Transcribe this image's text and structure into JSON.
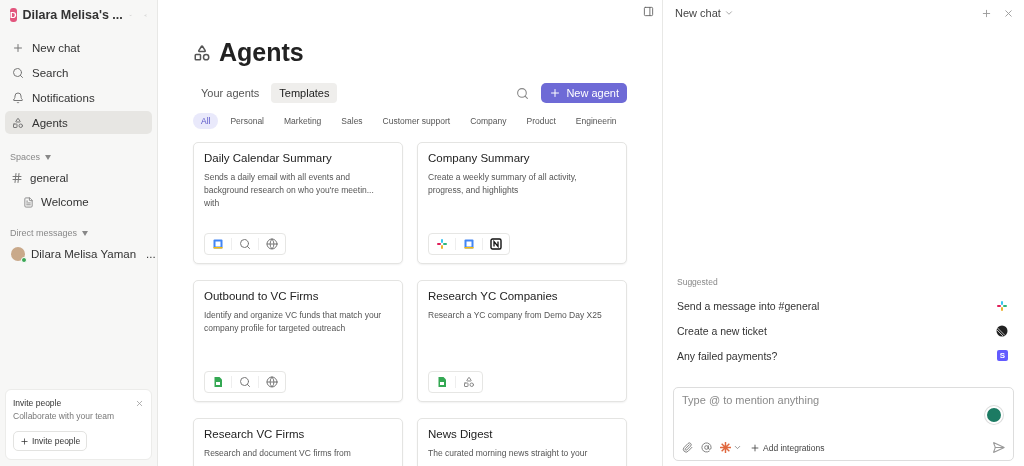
{
  "workspace": {
    "initial": "D",
    "name": "Dilara Melisa's ..."
  },
  "nav": [
    {
      "kind": "plus",
      "label": "New chat",
      "selected": false
    },
    {
      "kind": "search",
      "label": "Search",
      "selected": false
    },
    {
      "kind": "bell",
      "label": "Notifications",
      "selected": false
    },
    {
      "kind": "agents",
      "label": "Agents",
      "selected": true
    }
  ],
  "spaces": {
    "title": "Spaces",
    "items": [
      {
        "label": "general",
        "children": [
          {
            "label": "Welcome"
          }
        ]
      }
    ]
  },
  "direct_messages": {
    "title": "Direct messages",
    "items": [
      {
        "name": "Dilara Melisa Yaman",
        "more": "..."
      }
    ]
  },
  "invite": {
    "title": "Invite people",
    "text": "Collaborate with your team",
    "button": "Invite people"
  },
  "page": {
    "title": "Agents",
    "tabs": [
      {
        "label": "Your agents",
        "selected": false
      },
      {
        "label": "Templates",
        "selected": true
      }
    ],
    "new_button": "New agent",
    "filters": [
      {
        "label": "All",
        "selected": true
      },
      {
        "label": "Personal",
        "selected": false
      },
      {
        "label": "Marketing",
        "selected": false
      },
      {
        "label": "Sales",
        "selected": false
      },
      {
        "label": "Customer support",
        "selected": false
      },
      {
        "label": "Company",
        "selected": false
      },
      {
        "label": "Product",
        "selected": false
      },
      {
        "label": "Engineerin",
        "selected": false
      }
    ],
    "cards": [
      {
        "title": "Daily Calendar Summary",
        "description": "Sends a daily email with all events and background research on who you're meetin... with",
        "tools": [
          {
            "kind": "calendar"
          },
          {
            "kind": "search"
          },
          {
            "kind": "globe"
          }
        ]
      },
      {
        "title": "Company Summary",
        "description": "Create a weekly summary of all activity, progress, and highlights",
        "tools": [
          {
            "kind": "slack"
          },
          {
            "kind": "calendar"
          },
          {
            "kind": "notion"
          }
        ]
      },
      {
        "title": "Outbound to VC Firms",
        "description": "Identify and organize VC funds that match your company profile for targeted outreach",
        "tools": [
          {
            "kind": "sheets"
          },
          {
            "kind": "search"
          },
          {
            "kind": "globe"
          }
        ]
      },
      {
        "title": "Research YC Companies",
        "description": "Research a YC company from Demo Day X25",
        "tools": [
          {
            "kind": "sheets"
          },
          {
            "kind": "connector"
          }
        ]
      },
      {
        "title": "Research VC Firms",
        "description": "Research and document VC firms from"
      },
      {
        "title": "News Digest",
        "description": "The curated morning news straight to your"
      }
    ]
  },
  "chat": {
    "title": "New chat",
    "suggested_title": "Suggested",
    "suggested": [
      {
        "label": "Send a message into #general",
        "kind": "slack"
      },
      {
        "label": "Create a new ticket",
        "kind": "linear"
      },
      {
        "label": "Any failed payments?",
        "kind": "stripe",
        "badge": "S"
      }
    ],
    "placeholder": "Type @ to mention anything",
    "add_integrations": "Add integrations"
  }
}
